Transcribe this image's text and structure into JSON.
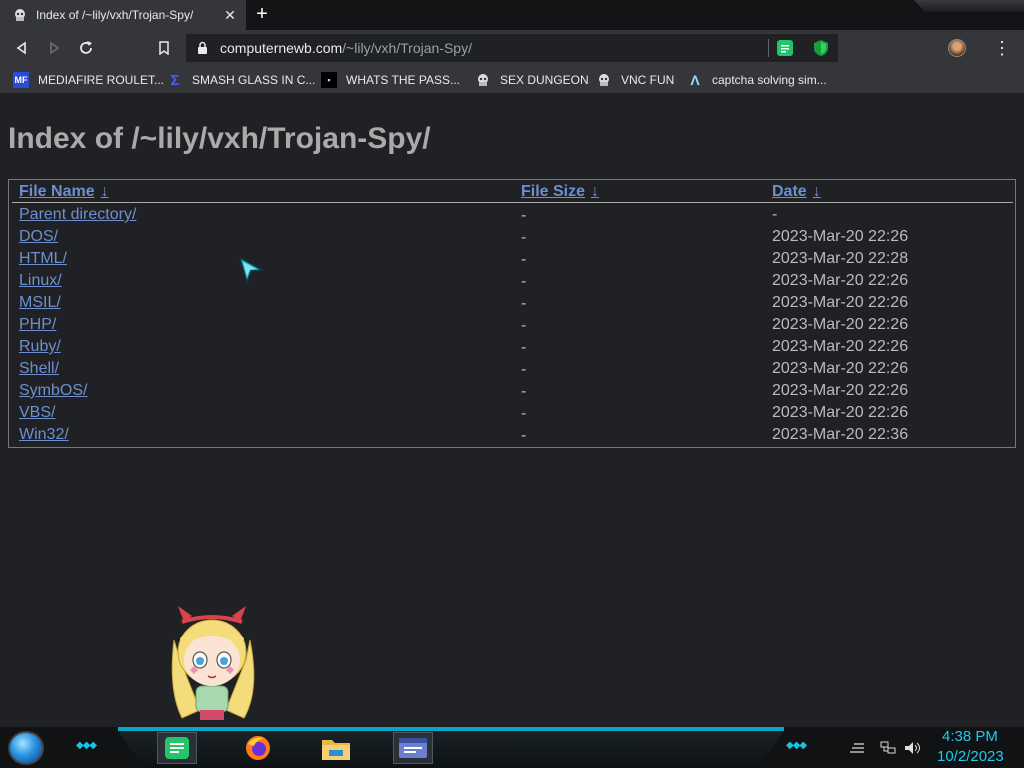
{
  "browser": {
    "tab": {
      "title": "Index of /~lily/vxh/Trojan-Spy/",
      "close": "✕"
    },
    "new_tab": "+",
    "address": {
      "host": "computernewb.com",
      "path": "/~lily/vxh/Trojan-Spy/"
    },
    "menu": "⋮"
  },
  "bookmarks": [
    {
      "label": "MEDIAFIRE ROULET...",
      "icon": "mediafire-icon",
      "badge": "MF"
    },
    {
      "label": "SMASH GLASS IN C...",
      "icon": "smash-icon",
      "badge": "Σ"
    },
    {
      "label": "WHATS THE PASS...",
      "icon": "pass-icon",
      "badge": "▪"
    },
    {
      "label": "SEX DUNGEON",
      "icon": "sex-dungeon-icon",
      "badge": ""
    },
    {
      "label": "VNC FUN",
      "icon": "vnc-icon",
      "badge": ""
    },
    {
      "label": "captcha solving sim...",
      "icon": "captcha-icon",
      "badge": "Λ"
    }
  ],
  "page": {
    "title": "Index of /~lily/vxh/Trojan-Spy/",
    "columns": {
      "name": "File Name",
      "size": "File Size",
      "date": "Date",
      "sort_arrow": "↓"
    },
    "rows": [
      {
        "name": "Parent directory/",
        "size": "-",
        "date": "-"
      },
      {
        "name": "DOS/",
        "size": "-",
        "date": "2023-Mar-20 22:26"
      },
      {
        "name": "HTML/",
        "size": "-",
        "date": "2023-Mar-20 22:28"
      },
      {
        "name": "Linux/",
        "size": "-",
        "date": "2023-Mar-20 22:26"
      },
      {
        "name": "MSIL/",
        "size": "-",
        "date": "2023-Mar-20 22:26"
      },
      {
        "name": "PHP/",
        "size": "-",
        "date": "2023-Mar-20 22:26"
      },
      {
        "name": "Ruby/",
        "size": "-",
        "date": "2023-Mar-20 22:26"
      },
      {
        "name": "Shell/",
        "size": "-",
        "date": "2023-Mar-20 22:26"
      },
      {
        "name": "SymbOS/",
        "size": "-",
        "date": "2023-Mar-20 22:26"
      },
      {
        "name": "VBS/",
        "size": "-",
        "date": "2023-Mar-20 22:26"
      },
      {
        "name": "Win32/",
        "size": "-",
        "date": "2023-Mar-20 22:36"
      }
    ]
  },
  "taskbar": {
    "apps": [
      "notes-app-icon",
      "firefox-icon",
      "file-explorer-icon",
      "window-app-icon"
    ],
    "clock": {
      "time": "4:38 PM",
      "date": "10/2/2023"
    },
    "accent": "#21c9e8"
  },
  "colors": {
    "link": "#6d8fcf",
    "background": "#202124",
    "heading": "#aaaaaa"
  }
}
